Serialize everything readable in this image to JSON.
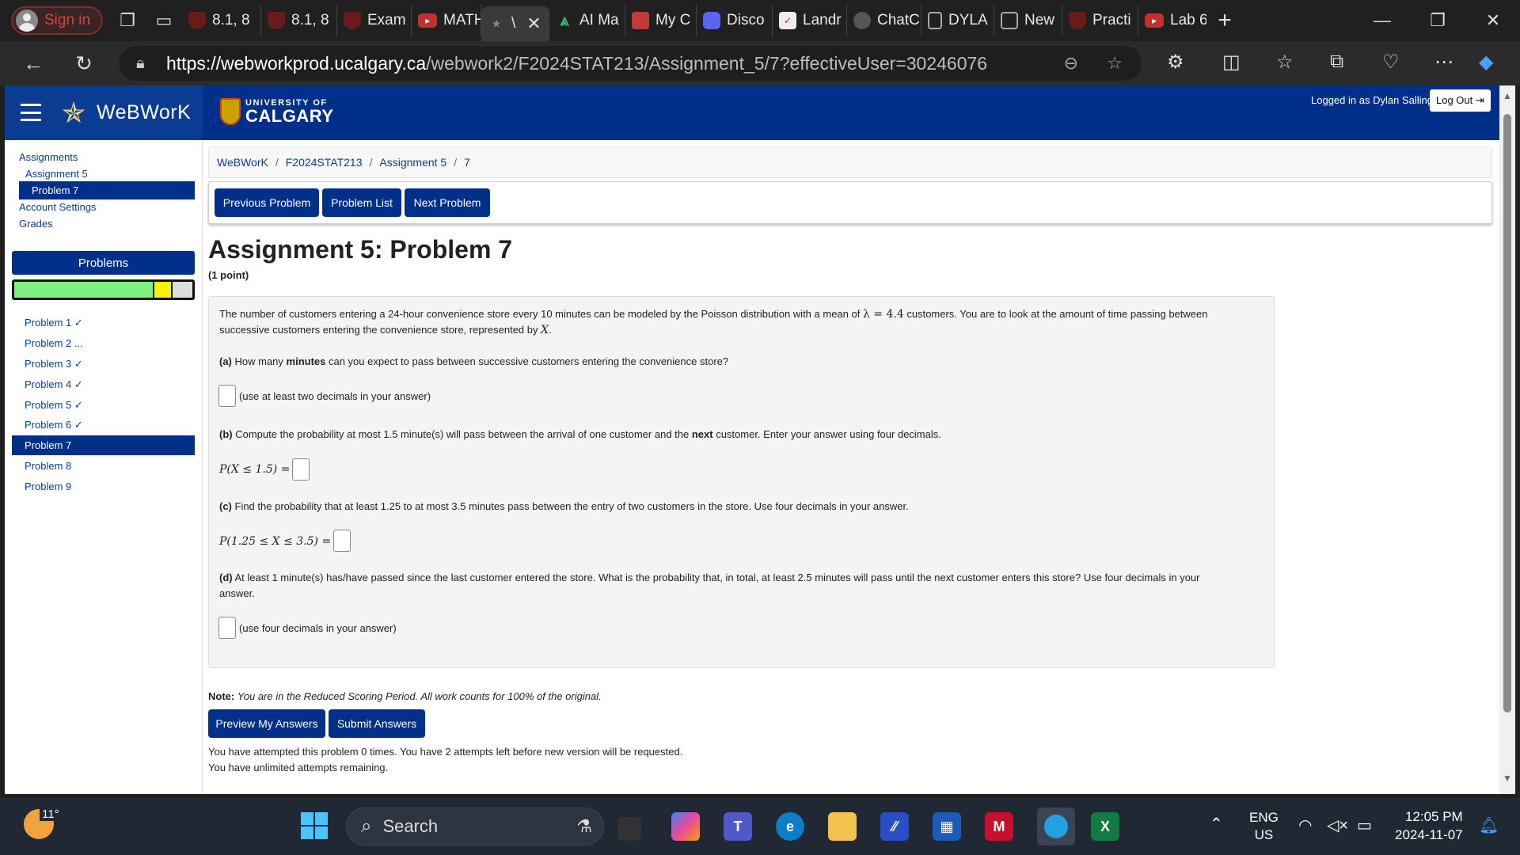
{
  "browser": {
    "signin_label": "Sign in",
    "tabs": [
      "8.1, 8",
      "8.1, 8",
      "Exam",
      "MATH",
      "\\",
      "AI Ma",
      "My C",
      "Disco",
      "Landr",
      "ChatC",
      "DYLA",
      "New",
      "Practi",
      "Lab 6"
    ],
    "new_tab": "+",
    "url_host": "https://webworkprod.ucalgary.ca",
    "url_path": "/webwork2/F2024STAT213/Assignment_5/7?effectiveUser=30246076"
  },
  "header": {
    "brand": "WeBWorK",
    "uc_small": "UNIVERSITY OF",
    "uc_big": "CALGARY",
    "logged_in": "Logged in as Dylan Salling.",
    "logout": "Log Out"
  },
  "sidebar": {
    "assignments": "Assignments",
    "assignment": "Assignment 5",
    "problem": "Problem 7",
    "account": "Account Settings",
    "grades": "Grades",
    "problems_heading": "Problems",
    "progress": {
      "correct": 7,
      "in_progress": 1,
      "total": 9
    },
    "items": [
      "Problem 1 ✓",
      "Problem 2 ...",
      "Problem 3 ✓",
      "Problem 4 ✓",
      "Problem 5 ✓",
      "Problem 6 ✓",
      "Problem 7",
      "Problem 8",
      "Problem 9"
    ]
  },
  "breadcrumb": [
    "WeBWorK",
    "F2024STAT213",
    "Assignment 5",
    "7"
  ],
  "nav": {
    "prev": "Previous Problem",
    "list": "Problem List",
    "next": "Next Problem"
  },
  "problem": {
    "title": "Assignment 5: Problem 7",
    "points": "(1 point)",
    "intro1": "The number of customers entering a 24-hour convenience store every 10 minutes can be modeled by the Poisson distribution with a mean of ",
    "lambda": "λ = 4.4",
    "intro2": " customers. You are to look at the amount of time passing between",
    "intro3": "successive customers entering the convenience store, represented by ",
    "x": "X",
    "a_label": "(a)",
    "a_text1": " How many ",
    "a_bold": "minutes",
    "a_text2": " can you expect to pass between successive customers entering the convenience store?",
    "a_hint": "(use at least two decimals in your answer)",
    "b_label": "(b)",
    "b_text1": " Compute the probability at most 1.5 minute(s) will pass between the arrival of one customer and the ",
    "b_bold": "next",
    "b_text2": " customer. Enter your answer using four decimals.",
    "b_math": "P(X ≤ 1.5) =",
    "c_label": "(c)",
    "c_text": " Find the probability that at least 1.25 to at most 3.5 minutes pass between the entry of two customers in the store. Use four decimals in your answer.",
    "c_math": "P(1.25 ≤ X ≤ 3.5) =",
    "d_label": "(d)",
    "d_text1": " At least 1 minute(s) has/have passed since the last customer entered the store. What is the probability that, in total, at least 2.5 minutes will pass until the next customer enters this store? Use four decimals in your",
    "d_text2": "answer.",
    "d_hint": "(use four decimals in your answer)"
  },
  "note": {
    "label": "Note:",
    "text": "You are in the Reduced Scoring Period. All work counts for 100% of the original."
  },
  "submit": {
    "preview": "Preview My Answers",
    "submit": "Submit Answers"
  },
  "status": {
    "line1": "You have attempted this problem 0 times. You have 2 attempts left before new version will be requested.",
    "line2": "You have unlimited attempts remaining."
  },
  "taskbar": {
    "temp": "11°",
    "search": "Search",
    "lang1": "ENG",
    "lang2": "US",
    "time": "12:05 PM",
    "date": "2024-11-07"
  },
  "colors": {
    "brand": "#00308a",
    "accent": "#0a3d91",
    "progress_correct": "#80f080",
    "progress_partial": "#f5f500"
  }
}
